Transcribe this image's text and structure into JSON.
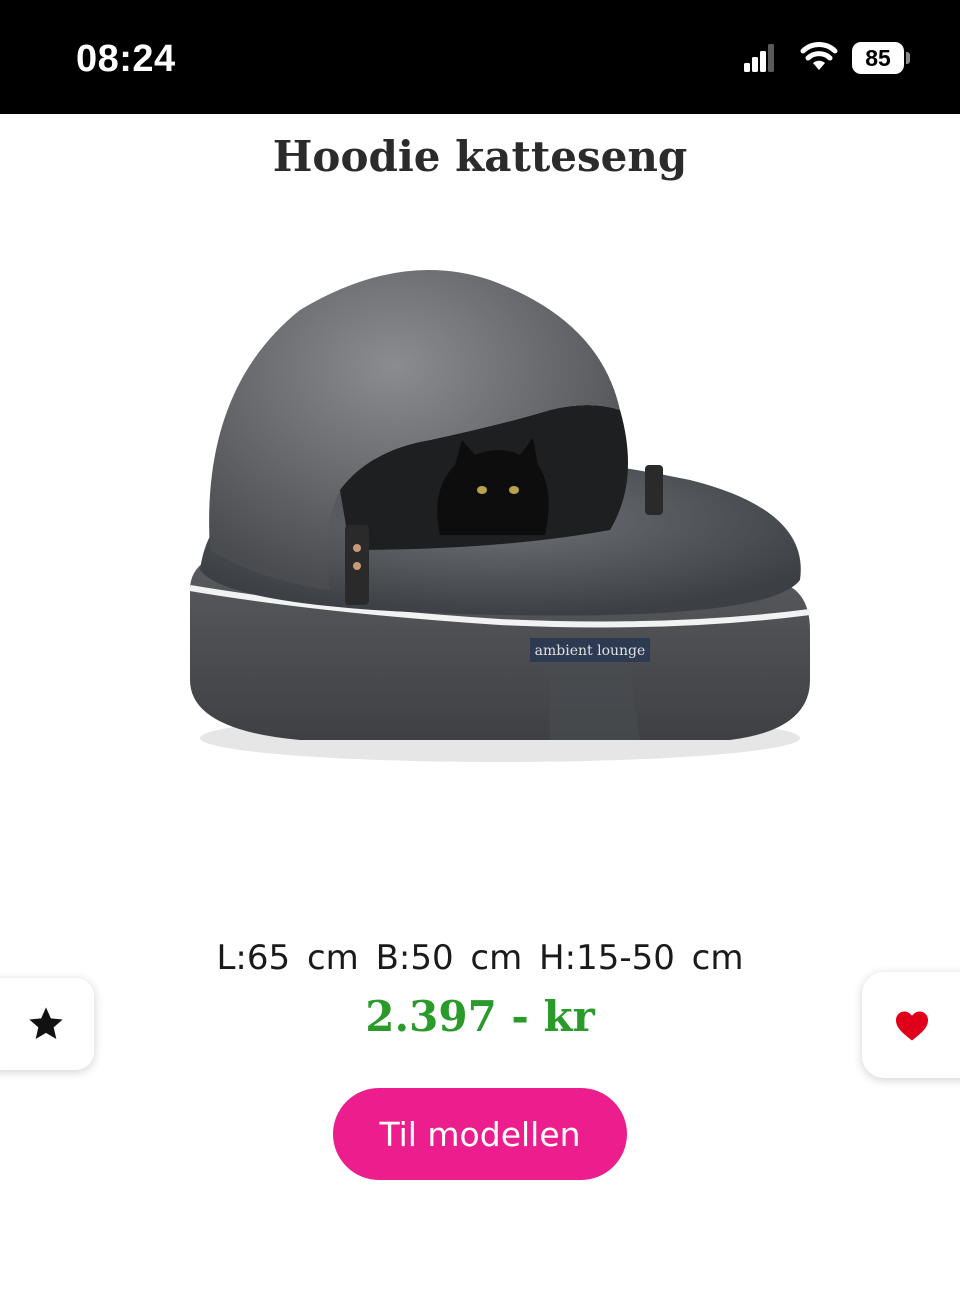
{
  "status_bar": {
    "time": "08:24",
    "battery_level": "85",
    "icons": [
      "signal-icon",
      "wifi-icon",
      "battery-icon"
    ]
  },
  "product": {
    "title": "Hoodie katteseng",
    "image_caption": "ambient lounge",
    "dimensions": "L:65 cm  B:50 cm  H:15-50 cm",
    "price": "2.397 - kr",
    "cta_label": "Til modellen"
  },
  "side_actions": {
    "left_icon": "star-icon",
    "right_icon": "heart-icon"
  },
  "colors": {
    "price": "#2a9a2a",
    "cta_background": "#ec1e8e",
    "heart": "#e0001b",
    "status_bar": "#000000"
  }
}
